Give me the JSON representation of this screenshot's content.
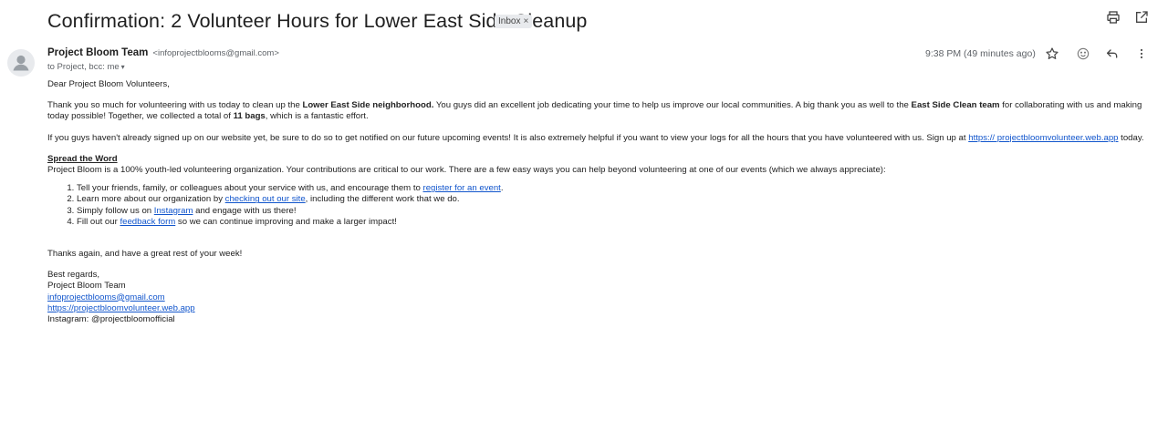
{
  "subject": "Confirmation: 2 Volunteer Hours for Lower East Side Cleanup",
  "label_chip": {
    "text": "Inbox",
    "close": "×"
  },
  "toolbar_icons": [
    "print-icon",
    "open-in-new-window-icon"
  ],
  "sender": {
    "name": "Project Bloom Team",
    "email": "<infoprojectblooms@gmail.com>",
    "recipients": "to Project, bcc: me",
    "caret": "▾"
  },
  "meta": {
    "time": "9:38 PM (49 minutes ago)",
    "icons": [
      "star-icon",
      "emoji-icon",
      "reply-icon",
      "more-vert-icon"
    ]
  },
  "body": {
    "greeting": "Dear Project Bloom Volunteers,",
    "p1": {
      "t1": "Thank you so much for volunteering with us today to clean up the ",
      "b1": "Lower East Side neighborhood.",
      "t2": " You guys did an excellent job dedicating your time to help us improve our local communities. A big thank you as well to the ",
      "b2": "East Side Clean team",
      "t3": " for collaborating with us and making today possible! Together, we collected a total of ",
      "b3": "11 bags",
      "t4": ", which is a fantastic effort."
    },
    "p2": {
      "t1": "If you guys haven't already signed up on our website yet, be sure to do so to get notified on our future upcoming events! It is also extremely helpful if you want to view your logs for all the hours that you have volunteered with us. Sign up at ",
      "link": "https:// projectbloomvolunteer.web.app",
      "t2": " today."
    },
    "spread_heading": "Spread the Word",
    "spread_intro": "Project Bloom is a 100% youth-led volunteering organization. Your contributions are critical to our work. There are a few easy ways you can help beyond volunteering at one of our events (which we always appreciate):",
    "list": [
      {
        "pre": "Tell your friends, family, or colleagues about your service with us, and encourage them to ",
        "link": "register for an event",
        "post": "."
      },
      {
        "pre": "Learn more about our organization by ",
        "link": "checking out our site",
        "post": ", including the different work that we do."
      },
      {
        "pre": "Simply follow us on ",
        "link": "Instagram",
        "post": " and engage with us there!"
      },
      {
        "pre": "Fill out our ",
        "link": "feedback form",
        "post": " so we can continue improving and make a larger impact!"
      }
    ],
    "thanks": "Thanks again, and have a great rest of your week!",
    "signoff": "Best regards,",
    "sig_name": "Project Bloom Team",
    "sig_email": "infoprojectblooms@gmail.com",
    "sig_site": "https://projectbloomvolunteer.web.app",
    "sig_instagram": "Instagram: @projectbloomofficial"
  }
}
